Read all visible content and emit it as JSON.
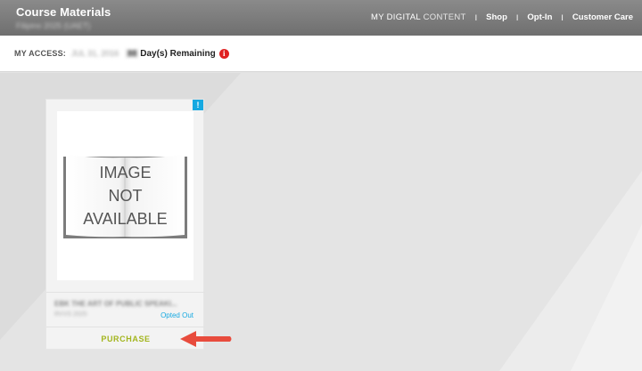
{
  "header": {
    "title": "Course Materials",
    "subtitle": "Filipino 2025 (UAET)",
    "nav": {
      "digital_content_a": "MY DIGITAL",
      "digital_content_b": "CONTENT",
      "shop": "Shop",
      "optin": "Opt-In",
      "care": "Customer Care",
      "separator": "I"
    }
  },
  "access": {
    "label": "MY ACCESS:",
    "date": "JUL 31, 2016",
    "days": "88",
    "remaining": "Day(s) Remaining",
    "info_glyph": "i"
  },
  "card": {
    "badge": "!",
    "image_text_1": "IMAGE",
    "image_text_2": "NOT",
    "image_text_3": "AVAILABLE",
    "title": "EBK THE ART OF PUBLIC SPEAKI...",
    "isbn": "RVVS 2025",
    "status": "Opted Out",
    "purchase_label": "PURCHASE"
  },
  "colors": {
    "accent_blue": "#16a9e1",
    "purchase_green": "#a3b51e",
    "arrow_red": "#e84c3d",
    "alert_red": "#e02020"
  },
  "icons": [
    "info-icon",
    "alert-icon",
    "arrow-icon"
  ]
}
